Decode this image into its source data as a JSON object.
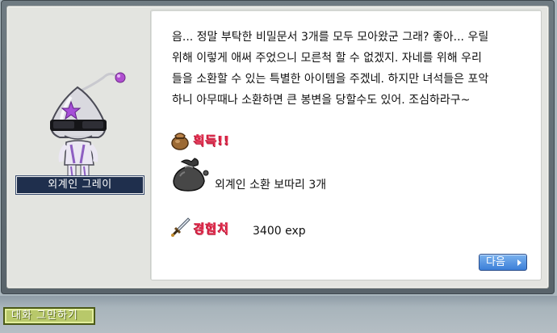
{
  "npc": {
    "name": "외계인 그레이"
  },
  "dialogue": {
    "lines": [
      "음... 정말 부탁한 비밀문서 3개를 모두 모아왔군 그래? 좋아... 우릴",
      "위해 이렇게 애써 주었으니 모른척 할 수 없겠지. 자네를 위해 우리",
      "들을 소환할 수 있는 특별한 아이템을 주겠네. 하지만 녀석들은 포악",
      "하니 아무때나 소환하면 큰 봉변을 당할수도 있어. 조심하라구~"
    ]
  },
  "rewards": {
    "obtain_title": "획득!!",
    "item_name": "외계인 소환 보따리 3개",
    "item_icon": "sack-icon",
    "exp_title": "경험치",
    "exp_value": "3400 exp",
    "exp_icon": "sword-icon"
  },
  "buttons": {
    "next": "다음",
    "end_chat": "대화 그만하기"
  },
  "colors": {
    "reward_title": "#e2284a",
    "npc_name_bg": "#1f2f4d",
    "next_button": "#3c7fd8",
    "end_chat_button": "#b8c86a"
  }
}
